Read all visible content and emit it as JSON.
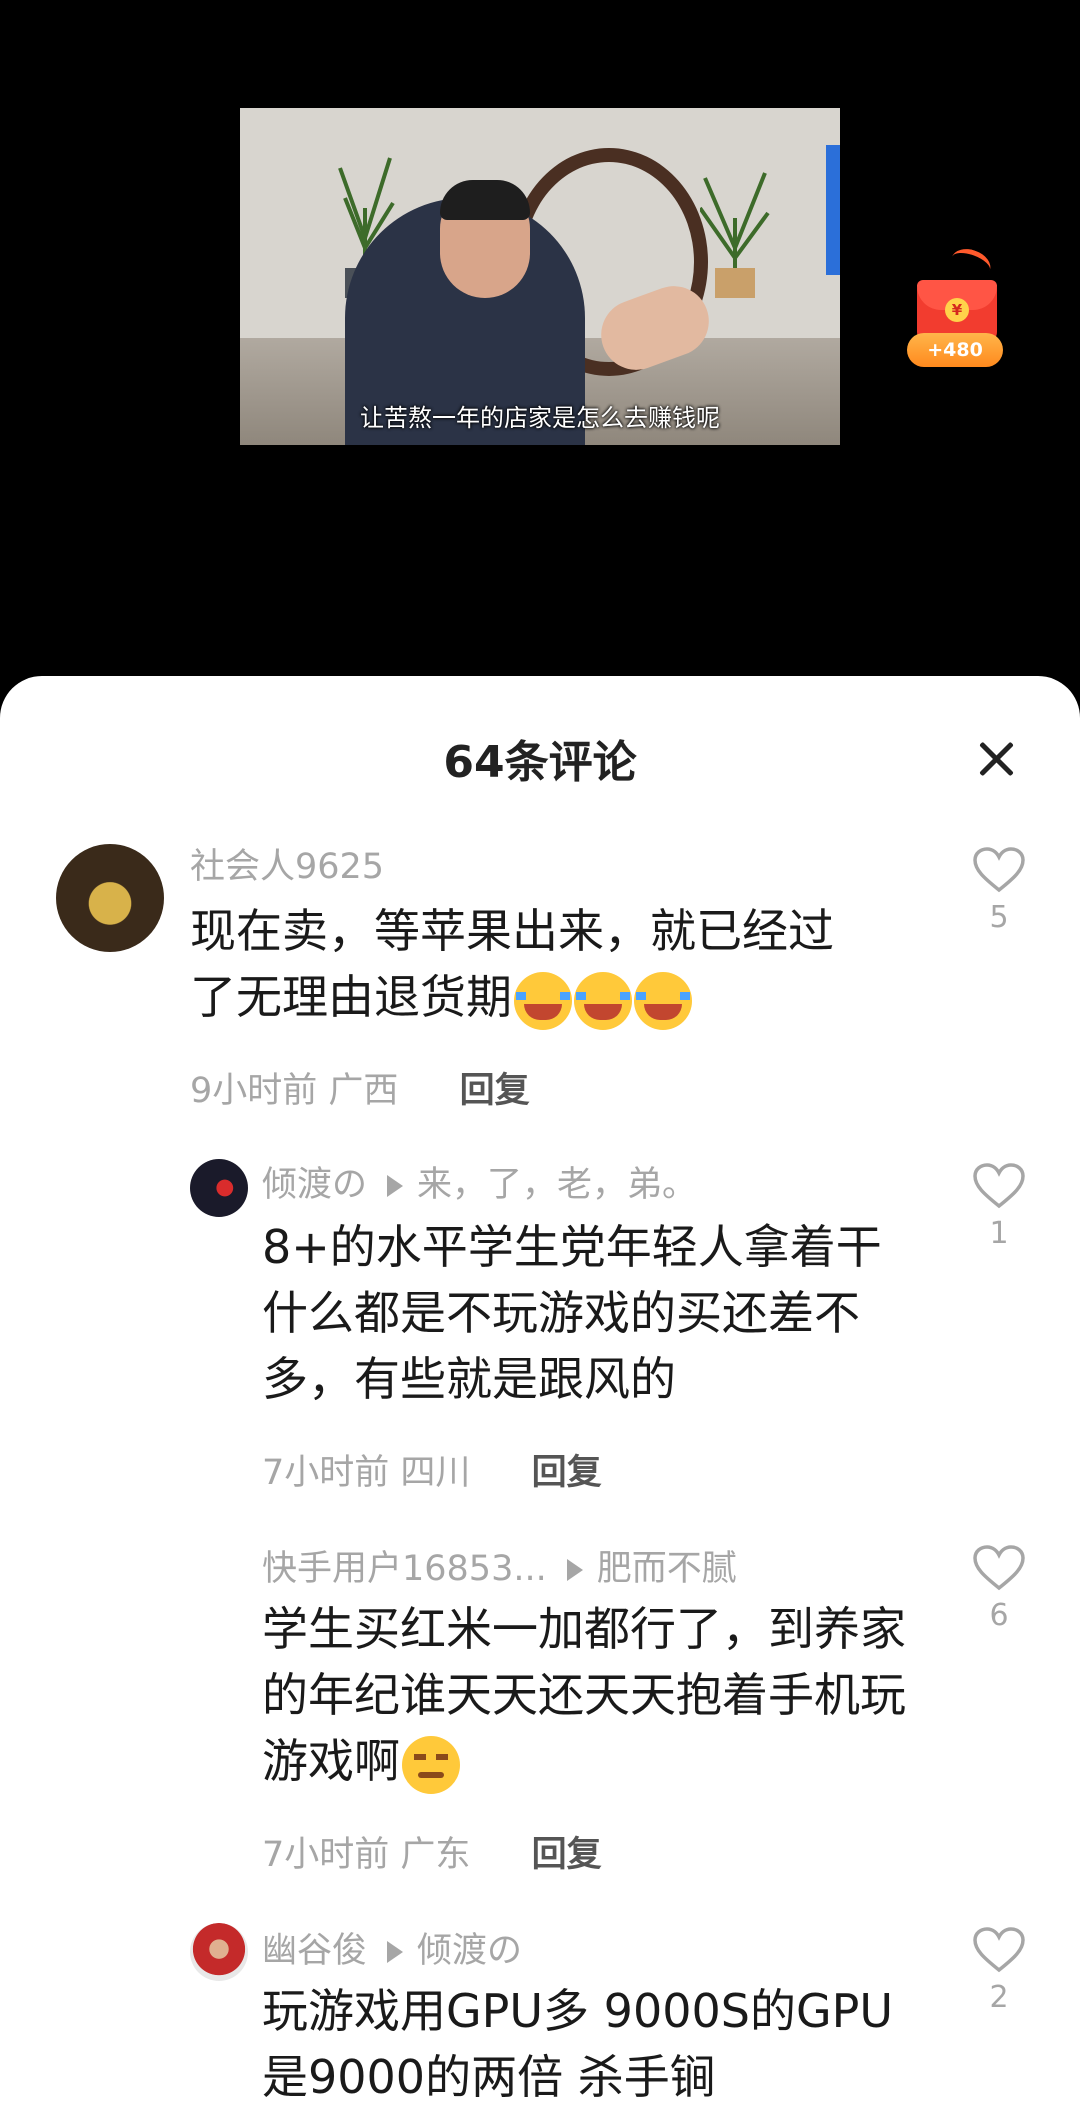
{
  "video": {
    "subtitle": "让苦熬一年的店家是怎么去赚钱呢",
    "red_packet_amount": "+480",
    "red_packet_symbol": "¥"
  },
  "sheet": {
    "title": "64条评论"
  },
  "comments": [
    {
      "user": "社会人9625",
      "text": "现在卖，等苹果出来，就已经过了无理由退货期",
      "time": "9小时前",
      "location": "广西",
      "reply": "回复",
      "likes": "5",
      "emoji": [
        "cry",
        "cry",
        "cry"
      ]
    },
    {
      "user": "倾渡の",
      "reply_to": "来，了，老，弟。",
      "text": "8+的水平学生党年轻人拿着干什么都是不玩游戏的买还差不多，有些就是跟风的",
      "time": "7小时前",
      "location": "四川",
      "reply": "回复",
      "likes": "1"
    },
    {
      "user": "快手用户16853...",
      "reply_to": "肥而不腻",
      "text": "学生买红米一加都行了，到养家的年纪谁天天还天天抱着手机玩游戏啊",
      "time": "7小时前",
      "location": "广东",
      "reply": "回复",
      "likes": "6",
      "emoji": [
        "smirk"
      ]
    },
    {
      "user": "幽谷俊",
      "reply_to": "倾渡の",
      "text": "玩游戏用GPU多 9000S的GPU是9000的两倍 杀手锏",
      "likes": "2"
    }
  ],
  "colors": {
    "accent_red": "#f23c2f",
    "muted": "#a6a6a6"
  }
}
